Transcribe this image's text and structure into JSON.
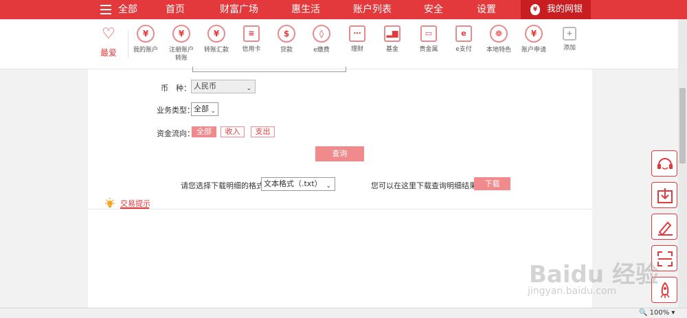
{
  "nav": {
    "all_label": "全部",
    "items": [
      "首页",
      "财富广场",
      "惠生活",
      "账户列表",
      "安全",
      "设置"
    ],
    "mybank_label": "我的网银"
  },
  "quick": {
    "fav_label": "最爱",
    "items": [
      {
        "label": "我的账户",
        "label2": "",
        "icon": "yen-circle-icon"
      },
      {
        "label": "注册账户",
        "label2": "转账",
        "icon": "transfer-yen-icon"
      },
      {
        "label": "转账汇款",
        "label2": "",
        "icon": "remit-yen-icon"
      },
      {
        "label": "信用卡",
        "label2": "",
        "icon": "credit-card-icon"
      },
      {
        "label": "贷款",
        "label2": "",
        "icon": "money-bag-icon"
      },
      {
        "label": "e缴费",
        "label2": "",
        "icon": "water-drop-icon"
      },
      {
        "label": "理财",
        "label2": "",
        "icon": "abacus-icon"
      },
      {
        "label": "基金",
        "label2": "",
        "icon": "bar-chart-icon"
      },
      {
        "label": "贵金属",
        "label2": "",
        "icon": "gold-bars-icon"
      },
      {
        "label": "e支付",
        "label2": "",
        "icon": "e-pay-icon"
      },
      {
        "label": "本地特色",
        "label2": "",
        "icon": "film-reel-icon"
      },
      {
        "label": "账户申请",
        "label2": "",
        "icon": "yen-apply-icon"
      },
      {
        "label": "添加",
        "label2": "",
        "icon": "plus-icon"
      }
    ]
  },
  "form": {
    "currency_label": "币　种：",
    "currency_value": "人民币",
    "biz_label": "业务类型：",
    "biz_value": "全部",
    "flow_label": "资金流向：",
    "flow_options": [
      "全部",
      "收入",
      "支出"
    ],
    "query_button": "查询"
  },
  "download": {
    "prompt": "请您选择下载明细的格式",
    "format_value": "文本格式（.txt）",
    "hint": "您可以在这里下载查询明细结果",
    "button": "下载"
  },
  "tip": {
    "label": "交易提示"
  },
  "status": {
    "zoom": "100%"
  },
  "watermark": {
    "main": "Baidu 经验",
    "sub": "jingyan.baidu.com"
  },
  "colors": {
    "brand": "#e4393c",
    "button": "#f08a8c"
  }
}
